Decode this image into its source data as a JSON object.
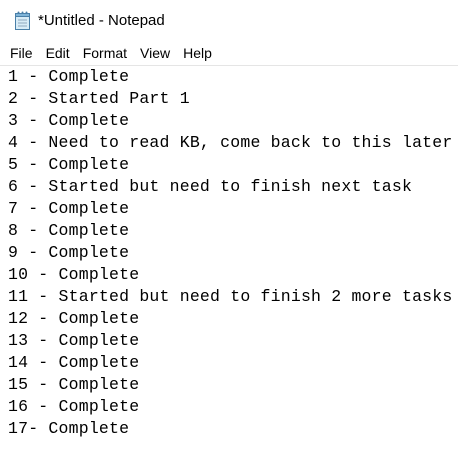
{
  "window": {
    "title": "*Untitled - Notepad",
    "icon": "notepad-icon"
  },
  "menu": {
    "items": [
      "File",
      "Edit",
      "Format",
      "View",
      "Help"
    ]
  },
  "editor": {
    "lines": [
      "1 - Complete",
      "2 - Started Part 1",
      "3 - Complete",
      "4 - Need to read KB, come back to this later",
      "5 - Complete",
      "6 - Started but need to finish next task",
      "7 - Complete",
      "8 - Complete",
      "9 - Complete",
      "10 - Complete",
      "11 - Started but need to finish 2 more tasks",
      "12 - Complete",
      "13 - Complete",
      "14 - Complete",
      "15 - Complete",
      "16 - Complete",
      "17- Complete"
    ]
  }
}
